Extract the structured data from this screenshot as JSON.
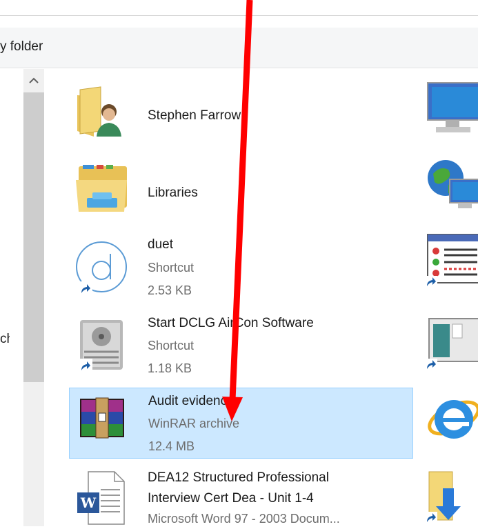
{
  "toolbar": {
    "label": "y folder"
  },
  "nav": {
    "fragment": "ch"
  },
  "items": [
    {
      "name": "Stephen Farrow",
      "icon": "user-folder-icon",
      "line2": "",
      "line3": ""
    },
    {
      "name": "Libraries",
      "icon": "libraries-icon",
      "line2": "",
      "line3": ""
    },
    {
      "name": "duet",
      "icon": "duet-shortcut-icon",
      "line2": "Shortcut",
      "line3": "2.53 KB"
    },
    {
      "name": "Start DCLG AirCon Software",
      "icon": "aircon-shortcut-icon",
      "line2": "Shortcut",
      "line3": "1.18 KB"
    },
    {
      "name": "Audit evidence",
      "icon": "winrar-archive-icon",
      "line2": "WinRAR archive",
      "line3": "12.4 MB",
      "selected": true
    },
    {
      "name": "DEA12  Structured Professional",
      "name2": "Interview Cert Dea - Unit 1-4",
      "icon": "word-document-icon",
      "line2": "Microsoft Word 97 - 2003 Docum..."
    }
  ],
  "right_column": [
    "this-pc-icon",
    "network-icon",
    "control-panel-shortcut-icon",
    "window-shortcut-icon",
    "internet-explorer-icon",
    "downloads-shortcut-icon"
  ],
  "annotation": {
    "color": "#ff0000"
  }
}
